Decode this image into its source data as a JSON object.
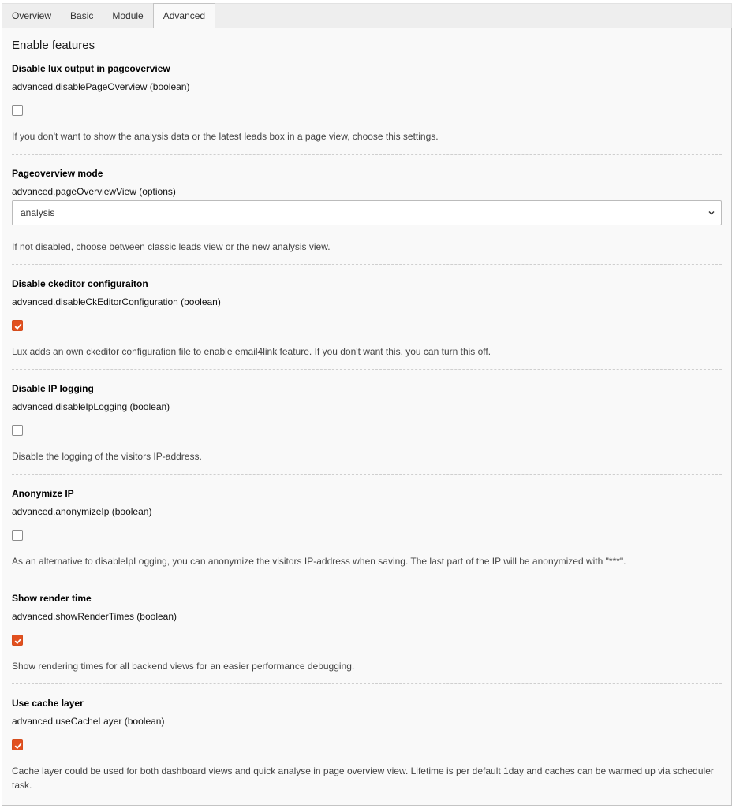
{
  "tabs": [
    {
      "label": "Overview",
      "active": false
    },
    {
      "label": "Basic",
      "active": false
    },
    {
      "label": "Module",
      "active": false
    },
    {
      "label": "Advanced",
      "active": true
    }
  ],
  "panel": {
    "title": "Enable features"
  },
  "items": [
    {
      "title": "Disable lux output in pageoverview",
      "key": "advanced.disablePageOverview (boolean)",
      "control": "checkbox",
      "checked": false,
      "description": "If you don't want to show the analysis data or the latest leads box in a page view, choose this settings."
    },
    {
      "title": "Pageoverview mode",
      "key": "advanced.pageOverviewView (options)",
      "control": "select",
      "selected": "analysis",
      "description": "If not disabled, choose between classic leads view or the new analysis view."
    },
    {
      "title": "Disable ckeditor configuraiton",
      "key": "advanced.disableCkEditorConfiguration (boolean)",
      "control": "checkbox",
      "checked": true,
      "description": "Lux adds an own ckeditor configuration file to enable email4link feature. If you don't want this, you can turn this off."
    },
    {
      "title": "Disable IP logging",
      "key": "advanced.disableIpLogging (boolean)",
      "control": "checkbox",
      "checked": false,
      "description": "Disable the logging of the visitors IP-address."
    },
    {
      "title": "Anonymize IP",
      "key": "advanced.anonymizeIp (boolean)",
      "control": "checkbox",
      "checked": false,
      "description": "As an alternative to disableIpLogging, you can anonymize the visitors IP-address when saving. The last part of the IP will be anonymized with \"***\"."
    },
    {
      "title": "Show render time",
      "key": "advanced.showRenderTimes (boolean)",
      "control": "checkbox",
      "checked": true,
      "description": "Show rendering times for all backend views for an easier performance debugging."
    },
    {
      "title": "Use cache layer",
      "key": "advanced.useCacheLayer (boolean)",
      "control": "checkbox",
      "checked": true,
      "description": "Cache layer could be used for both dashboard views and quick analyse in page overview view. Lifetime is per default 1day and caches can be warmed up via scheduler task."
    }
  ],
  "colors": {
    "accent": "#e2501f",
    "panel_bg": "#f9f9f9",
    "tab_bar_bg": "#eeeeee"
  }
}
